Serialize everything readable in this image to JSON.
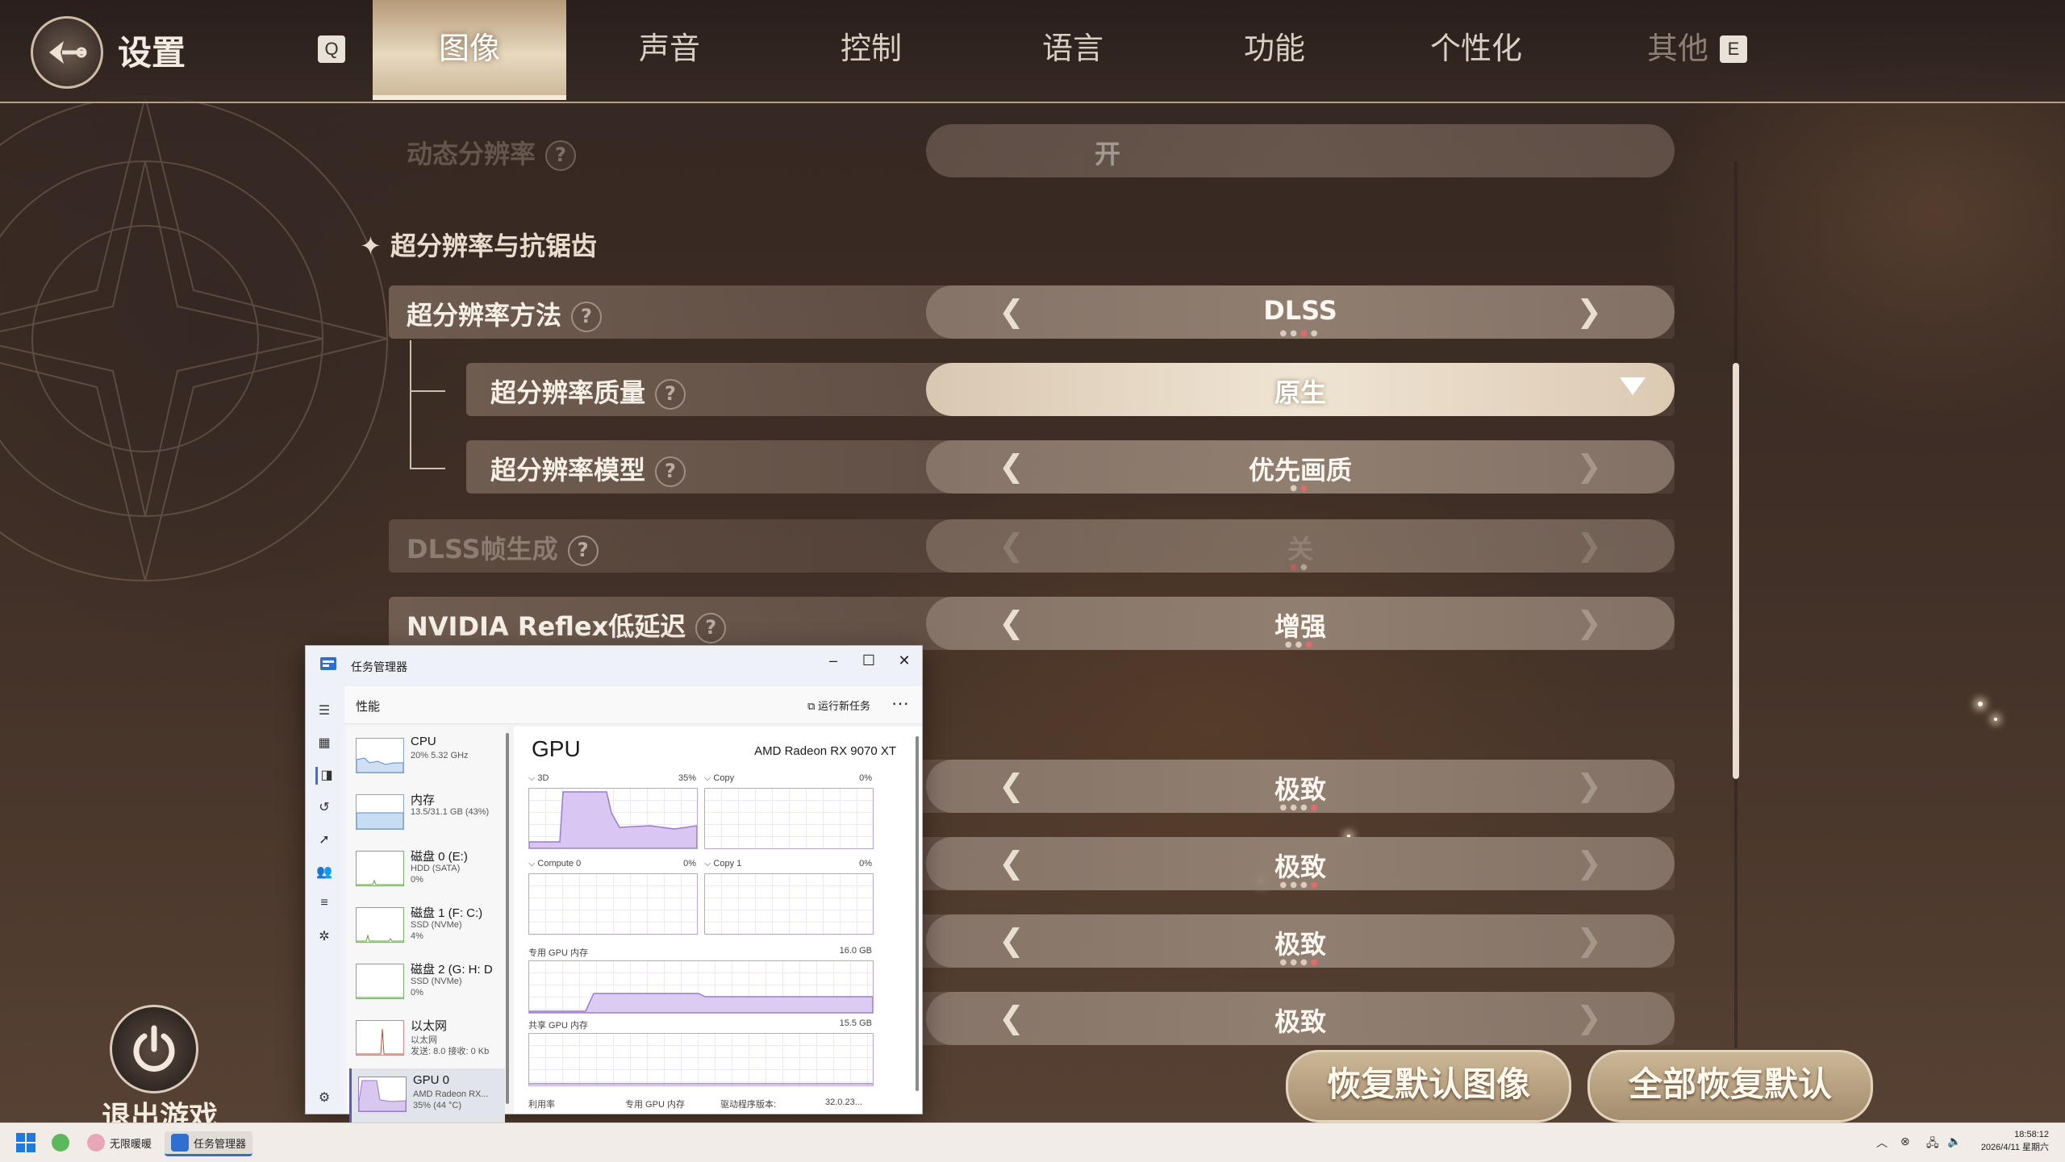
{
  "header": {
    "title": "设置",
    "key_left": "Q",
    "key_right": "E",
    "tabs": [
      {
        "label": "图像",
        "active": true
      },
      {
        "label": "声音",
        "active": false
      },
      {
        "label": "控制",
        "active": false
      },
      {
        "label": "语言",
        "active": false
      },
      {
        "label": "功能",
        "active": false
      },
      {
        "label": "个性化",
        "active": false
      },
      {
        "label": "其他",
        "active": false
      }
    ]
  },
  "settings": {
    "dynamic_res": {
      "label": "动态分辨率",
      "value": "开"
    },
    "section_title": "超分辨率与抗锯齿",
    "rows": [
      {
        "label": "超分辨率方法",
        "value": "DLSS",
        "dots_total": 4,
        "dot_active": 3
      },
      {
        "label": "超分辨率质量",
        "value": "原生",
        "dropdown": true
      },
      {
        "label": "超分辨率模型",
        "value": "优先画质",
        "dots_total": 2,
        "dot_active": 2
      },
      {
        "label": "DLSS帧生成",
        "value": "关",
        "dots_total": 2,
        "dot_active": 1
      },
      {
        "label": "NVIDIA Reflex低延迟",
        "value": "增强",
        "dots_total": 3,
        "dot_active": 3
      }
    ],
    "lower_values": [
      "极致",
      "极致",
      "极致",
      "极致"
    ],
    "lower_dot_active": [
      4,
      4,
      4,
      4
    ]
  },
  "buttons": {
    "restore_image": "恢复默认图像",
    "restore_all": "全部恢复默认",
    "exit_game": "退出游戏"
  },
  "task_manager": {
    "title": "任务管理器",
    "section": "性能",
    "run_new_task": "运行新任务",
    "more": "···",
    "items": [
      {
        "name": "CPU",
        "l1": "20% 5.32 GHz",
        "l2": ""
      },
      {
        "name": "内存",
        "l1": "13.5/31.1 GB (43%)",
        "l2": ""
      },
      {
        "name": "磁盘 0 (E:)",
        "l1": "HDD (SATA)",
        "l2": "0%"
      },
      {
        "name": "磁盘 1 (F: C:)",
        "l1": "SSD (NVMe)",
        "l2": "4%"
      },
      {
        "name": "磁盘 2 (G: H: D",
        "l1": "SSD (NVMe)",
        "l2": "0%"
      },
      {
        "name": "以太网",
        "l1": "以太网",
        "l2": "发送: 8.0 接收: 0 Kb"
      },
      {
        "name": "GPU 0",
        "l1": "AMD Radeon RX...",
        "l2": "35% (44 °C)"
      }
    ],
    "gpu_title": "GPU",
    "gpu_model": "AMD Radeon RX 9070 XT",
    "engines": [
      {
        "name": "3D",
        "pct": "35%"
      },
      {
        "name": "Copy",
        "pct": "0%"
      },
      {
        "name": "Compute 0",
        "pct": "0%"
      },
      {
        "name": "Copy 1",
        "pct": "0%"
      }
    ],
    "dedicated_label": "专用 GPU 内存",
    "dedicated_max": "16.0 GB",
    "shared_label": "共享 GPU 内存",
    "shared_max": "15.5 GB",
    "footer": {
      "util": "利用率",
      "ded": "专用 GPU 内存",
      "driver": "驱动程序版本:",
      "driver_val": "32.0.23..."
    }
  },
  "taskbar": {
    "apps": [
      {
        "label": "无限暖暖"
      },
      {
        "label": "任务管理器"
      }
    ],
    "time": "18:58:12",
    "date": "2026/4/11 星期六"
  },
  "colors": {
    "accent_active_tab": "#e8d9c0",
    "dot_active": "#e26a6a",
    "tm_purple": "#9a7ad0"
  }
}
